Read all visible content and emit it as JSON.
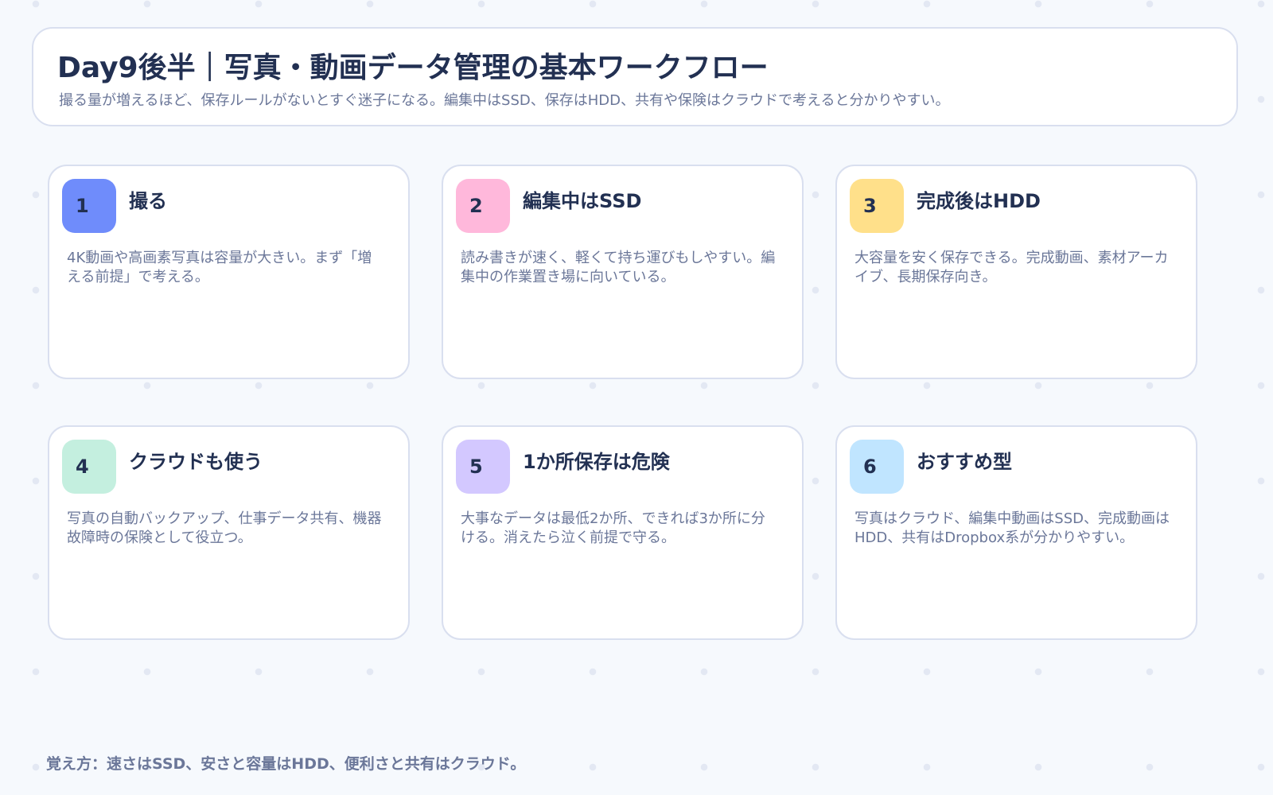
{
  "header": {
    "title": "Day9後半｜写真・動画データ管理の基本ワークフロー",
    "subtitle": "撮る量が増えるほど、保存ルールがないとすぐ迷子になる。編集中はSSD、保存はHDD、共有や保険はクラウドで考えると分かりやすい。"
  },
  "cards": [
    {
      "number": "1",
      "title": "撮る",
      "body": "4K動画や高画素写真は容量が大きい。まず「増える前提」で考える。",
      "color": "#6f8cfb"
    },
    {
      "number": "2",
      "title": "編集中はSSD",
      "body": "読み書きが速く、軽くて持ち運びもしやすい。編集中の作業置き場に向いている。",
      "color": "#ffb8db"
    },
    {
      "number": "3",
      "title": "完成後はHDD",
      "body": "大容量を安く保存できる。完成動画、素材アーカイブ、長期保存向き。",
      "color": "#ffe08a"
    },
    {
      "number": "4",
      "title": "クラウドも使う",
      "body": "写真の自動バックアップ、仕事データ共有、機器故障時の保険として役立つ。",
      "color": "#c4efdf"
    },
    {
      "number": "5",
      "title": "1か所保存は危険",
      "body": "大事なデータは最低2か所、できれば3か所に分ける。消えたら泣く前提で守る。",
      "color": "#d3c8ff"
    },
    {
      "number": "6",
      "title": "おすすめ型",
      "body": "写真はクラウド、編集中動画はSSD、完成動画はHDD、共有はDropbox系が分かりやすい。",
      "color": "#c0e5ff"
    }
  ],
  "footer": {
    "text": "覚え方：速さはSSD、安さと容量はHDD、便利さと共有はクラウド。"
  }
}
